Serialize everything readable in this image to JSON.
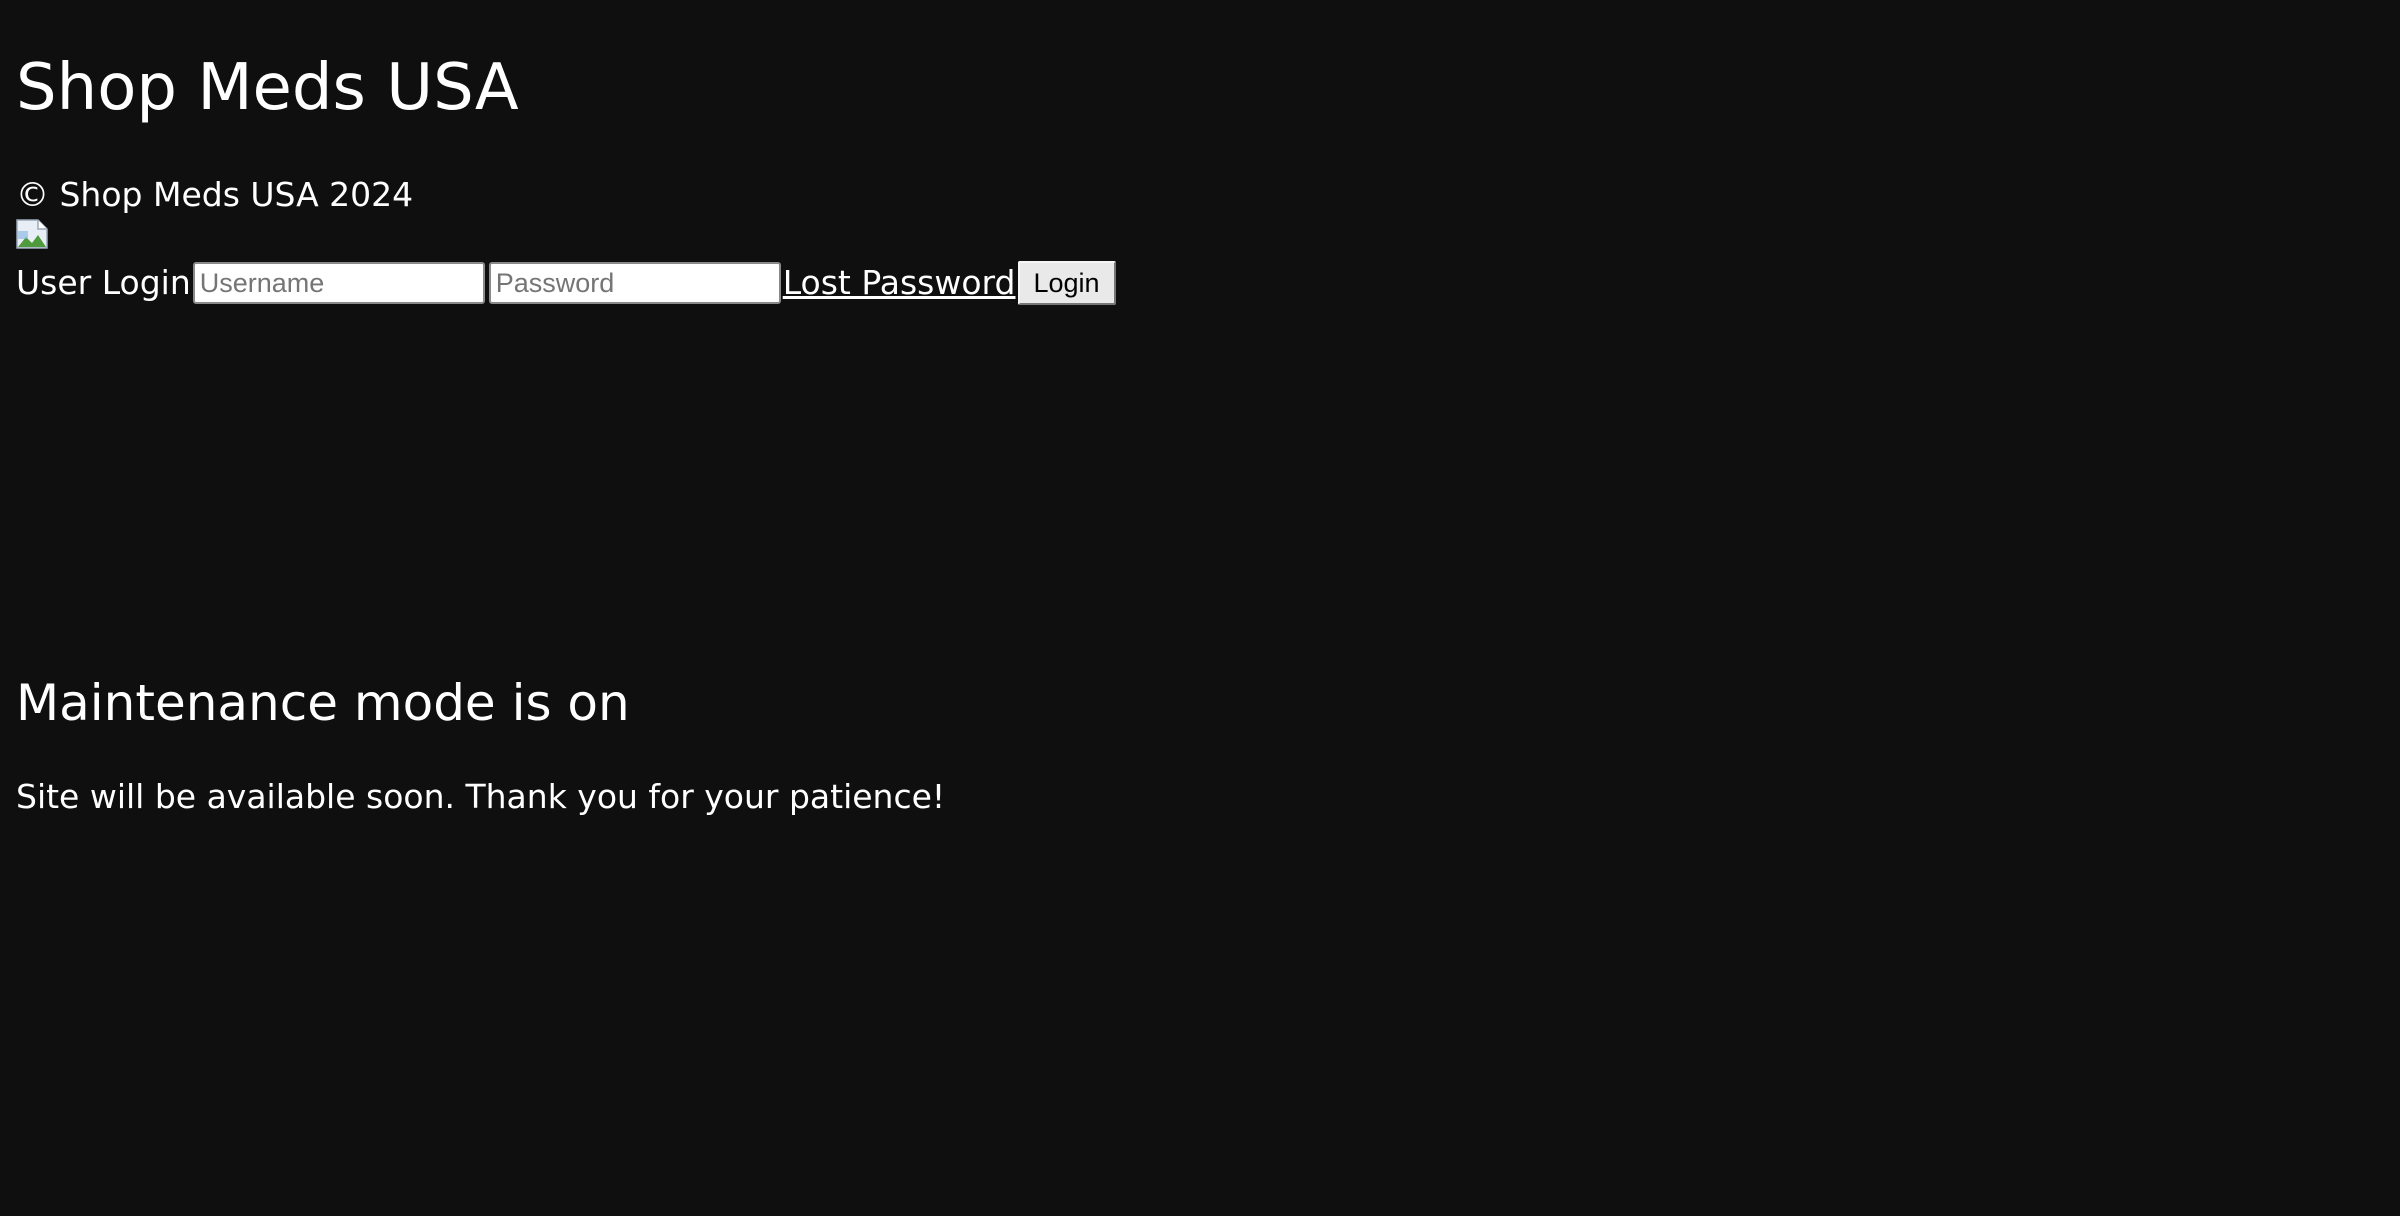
{
  "header": {
    "title": "Shop Meds USA",
    "copyright": "© Shop Meds USA 2024",
    "image_icon": "broken-image-icon"
  },
  "login": {
    "label": "User Login",
    "username_placeholder": "Username",
    "username_value": "",
    "password_placeholder": "Password",
    "password_value": "",
    "lost_password_label": "Lost Password",
    "login_button_label": "Login"
  },
  "maintenance": {
    "heading": "Maintenance mode is on",
    "message": "Site will be available soon. Thank you for your patience!"
  },
  "colors": {
    "background": "#0f0f0f",
    "text": "#ffffff"
  }
}
